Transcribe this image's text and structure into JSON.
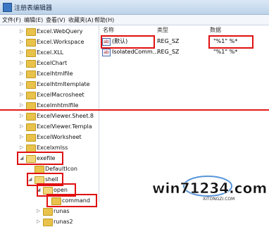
{
  "window": {
    "title": "注册表编辑器"
  },
  "menu": [
    "文件(F)",
    "编辑(E)",
    "查看(V)",
    "收藏夹(A)",
    "帮助(H)"
  ],
  "tree": [
    {
      "label": "Excel.WebQuery",
      "level": 1
    },
    {
      "label": "Excel.Workspace",
      "level": 1
    },
    {
      "label": "Excel.XLL",
      "level": 1
    },
    {
      "label": "ExcelChart",
      "level": 1
    },
    {
      "label": "Excelhtmlfile",
      "level": 1
    },
    {
      "label": "Excelhtmltemplate",
      "level": 1
    },
    {
      "label": "ExcelMacrosheet",
      "level": 1
    },
    {
      "label": "Excelmhtmlfile",
      "level": 1
    },
    {
      "label": "ExcelViewer.Sheet.8",
      "level": 1
    },
    {
      "label": "ExcelViewer.Templa",
      "level": 1
    },
    {
      "label": "ExcelWorksheet",
      "level": 1
    },
    {
      "label": "Excelxmlss",
      "level": 1
    },
    {
      "label": "exefile",
      "level": 1
    },
    {
      "label": "DefaultIcon",
      "level": 2
    },
    {
      "label": "shell",
      "level": 2
    },
    {
      "label": "open",
      "level": 3
    },
    {
      "label": "command",
      "level": 4
    },
    {
      "label": "runas",
      "level": 3
    },
    {
      "label": "runas2",
      "level": 3
    }
  ],
  "columns": {
    "name": "名称",
    "type": "类型",
    "data": "数据"
  },
  "values": [
    {
      "name": "(默认)",
      "type": "REG_SZ",
      "data": "\"%1\" %*"
    },
    {
      "name": "IsolatedComm...",
      "type": "REG_SZ",
      "data": "\"%1\" %*"
    }
  ],
  "watermark": {
    "text": "win71234.com",
    "sub": "XITONGZI.COM"
  }
}
